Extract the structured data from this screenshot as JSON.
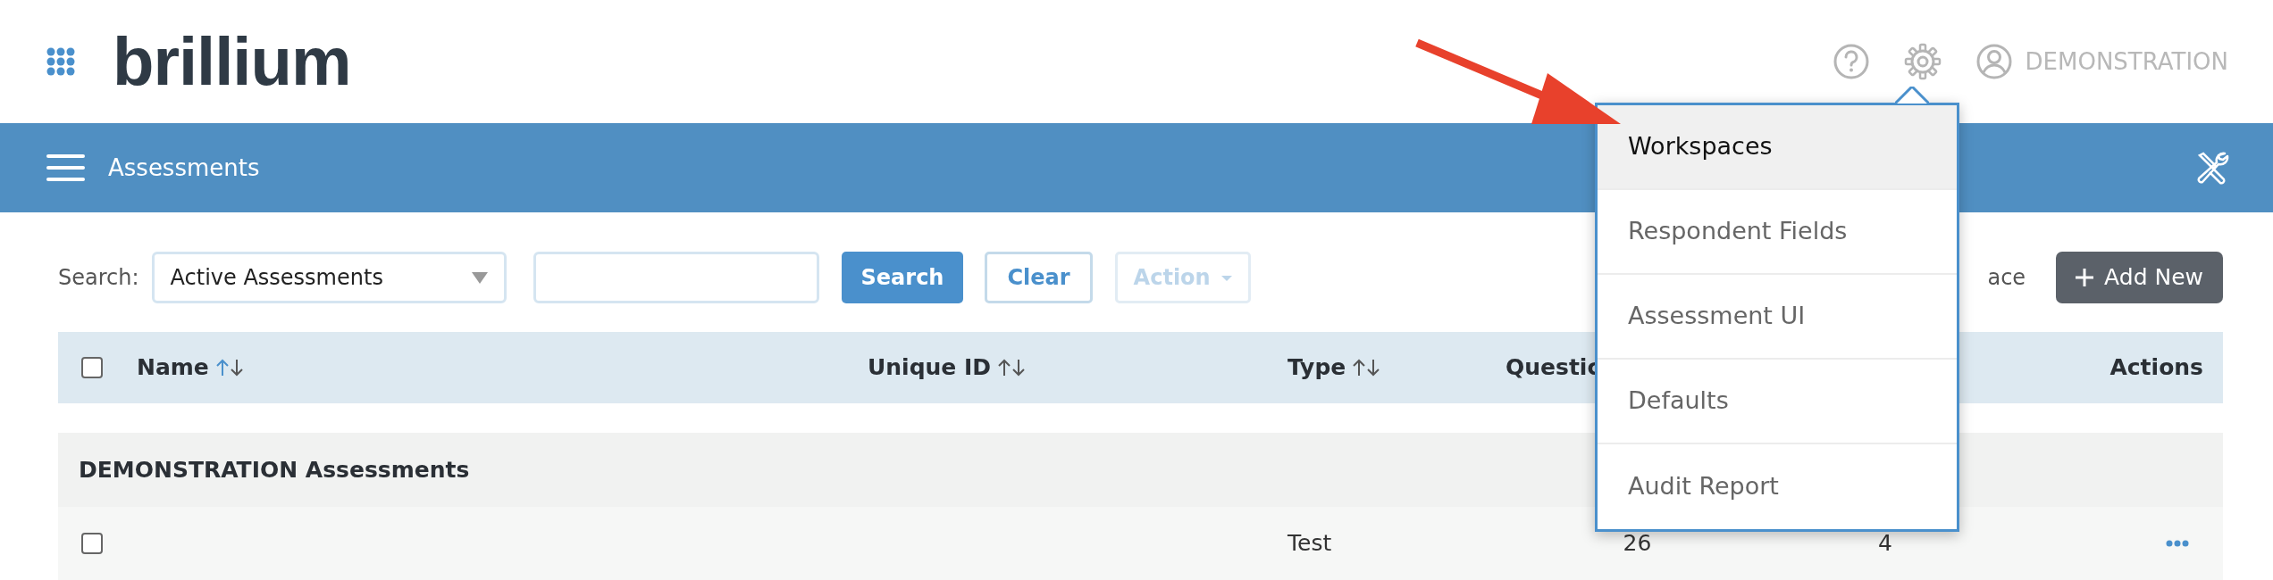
{
  "logo": {
    "text": "brillium"
  },
  "header": {
    "user_name": "DEMONSTRATION"
  },
  "navbar": {
    "title": "Assessments"
  },
  "toolbar": {
    "search_label": "Search:",
    "filter": "Active Assessments",
    "buttons": [
      {
        "label": "Search",
        "kind": "primary",
        "disabled": false
      },
      {
        "label": "Clear",
        "kind": "outline",
        "disabled": false
      },
      {
        "label": "Action",
        "kind": "dropdown",
        "disabled": true
      }
    ],
    "partial_text": "ace",
    "add_button": "Add New"
  },
  "table": {
    "select_all": {
      "checked": false
    },
    "columns": [
      {
        "label": "Name",
        "sortable": true,
        "sorted_ascending": true
      },
      {
        "label": "Unique ID",
        "sortable": true,
        "sorted_ascending": false
      },
      {
        "label": "Type",
        "sortable": true,
        "sorted_ascending": false
      },
      {
        "label": "Questic",
        "sortable": false
      },
      {
        "label": "Actions",
        "sortable": false
      }
    ],
    "group": {
      "label": "DEMONSTRATION Assessments"
    },
    "rows": [
      {
        "checked": false,
        "type": "Test",
        "column_5": "26",
        "column_6": "4"
      }
    ]
  },
  "settings_menu": {
    "items": [
      {
        "label": "Workspaces",
        "selected": true
      },
      {
        "label": "Respondent Fields",
        "selected": false
      },
      {
        "label": "Assessment UI",
        "selected": false
      },
      {
        "label": "Defaults",
        "selected": false
      },
      {
        "label": "Audit Report",
        "selected": false
      }
    ]
  },
  "annotation_arrow": true
}
